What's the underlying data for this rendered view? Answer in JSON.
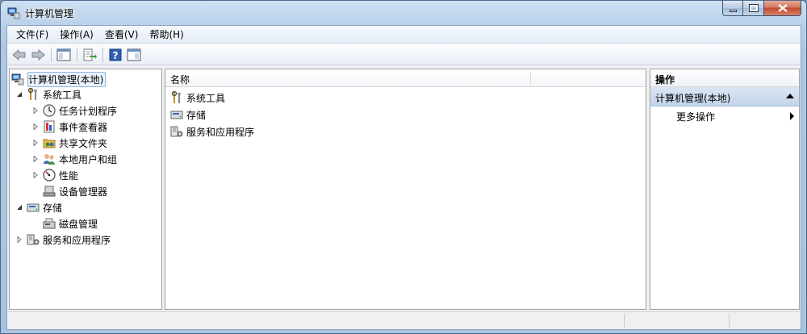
{
  "window": {
    "title": "计算机管理"
  },
  "menu": [
    {
      "label": "文件(F)"
    },
    {
      "label": "操作(A)"
    },
    {
      "label": "查看(V)"
    },
    {
      "label": "帮助(H)"
    }
  ],
  "tree": {
    "root": "计算机管理(本地)",
    "system_tools": "系统工具",
    "task_scheduler": "任务计划程序",
    "event_viewer": "事件查看器",
    "shared_folders": "共享文件夹",
    "local_users": "本地用户和组",
    "performance": "性能",
    "device_manager": "设备管理器",
    "storage": "存储",
    "disk_management": "磁盘管理",
    "services_apps": "服务和应用程序"
  },
  "list": {
    "column_name": "名称",
    "items": [
      "系统工具",
      "存储",
      "服务和应用程序"
    ]
  },
  "actions": {
    "title": "操作",
    "section": "计算机管理(本地)",
    "more": "更多操作"
  }
}
